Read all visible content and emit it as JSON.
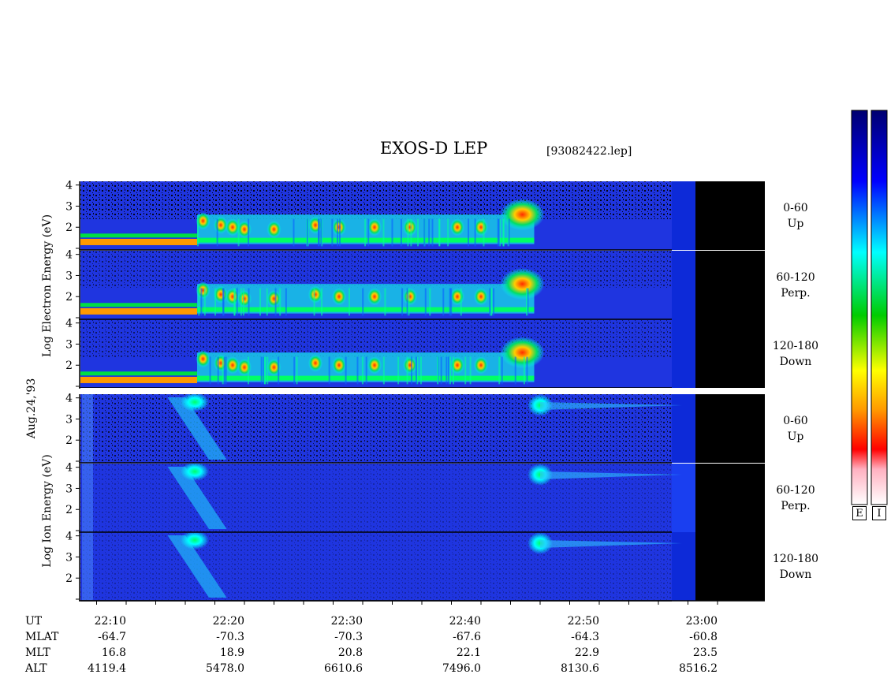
{
  "title": "EXOS-D LEP",
  "filename": "[93082422.lep]",
  "date_label": "Aug.24,'93",
  "electron_axis_label": "Log Electron Energy (eV)",
  "ion_axis_label": "Log Ion Energy (eV)",
  "panels": [
    {
      "species": "electron",
      "pitch": "0-60",
      "dir": "Up"
    },
    {
      "species": "electron",
      "pitch": "60-120",
      "dir": "Perp."
    },
    {
      "species": "electron",
      "pitch": "120-180",
      "dir": "Down"
    },
    {
      "species": "ion",
      "pitch": "0-60",
      "dir": "Up"
    },
    {
      "species": "ion",
      "pitch": "60-120",
      "dir": "Perp."
    },
    {
      "species": "ion",
      "pitch": "120-180",
      "dir": "Down"
    }
  ],
  "colorbar_labels": [
    "E",
    "I"
  ],
  "time_table": {
    "row_labels": [
      "UT",
      "MLAT",
      "MLT",
      "ALT"
    ],
    "columns": [
      {
        "UT": "22:10",
        "MLAT": "-64.7",
        "MLT": "16.8",
        "ALT": "4119.4"
      },
      {
        "UT": "22:20",
        "MLAT": "-70.3",
        "MLT": "18.9",
        "ALT": "5478.0"
      },
      {
        "UT": "22:30",
        "MLAT": "-70.3",
        "MLT": "20.8",
        "ALT": "6610.6"
      },
      {
        "UT": "22:40",
        "MLAT": "-67.6",
        "MLT": "22.1",
        "ALT": "7496.0"
      },
      {
        "UT": "22:50",
        "MLAT": "-64.3",
        "MLT": "22.9",
        "ALT": "8130.6"
      },
      {
        "UT": "23:00",
        "MLAT": "-60.8",
        "MLT": "23.5",
        "ALT": "8516.2"
      }
    ]
  },
  "colors": {
    "background_blue": "#1a2fd6",
    "dark_blue": "#0a1880",
    "no_data": "#000000"
  },
  "chart_data": {
    "type": "heatmap",
    "title": "EXOS-D LEP",
    "x_label": "UT",
    "x_ticks": [
      "22:10",
      "22:20",
      "22:30",
      "22:40",
      "22:50",
      "23:00"
    ],
    "x_range": [
      "22:06",
      "23:03"
    ],
    "y_label": "Log Energy (eV)",
    "y_ticks": [
      1,
      2,
      3,
      4
    ],
    "y_range": [
      1,
      4.1
    ],
    "panels": [
      {
        "species": "electron",
        "pitch_angle": "0-60",
        "direction": "Up"
      },
      {
        "species": "electron",
        "pitch_angle": "60-120",
        "direction": "Perp."
      },
      {
        "species": "electron",
        "pitch_angle": "120-180",
        "direction": "Down"
      },
      {
        "species": "ion",
        "pitch_angle": "0-60",
        "direction": "Up"
      },
      {
        "species": "ion",
        "pitch_angle": "60-120",
        "direction": "Perp."
      },
      {
        "species": "ion",
        "pitch_angle": "120-180",
        "direction": "Down"
      }
    ],
    "colorbars": [
      "E",
      "I"
    ],
    "colormap": [
      "#ffffff",
      "#ffb0c0",
      "#ff0000",
      "#ff9900",
      "#ffff00",
      "#00cc00",
      "#00ffff",
      "#0000ff",
      "#000070"
    ]
  }
}
